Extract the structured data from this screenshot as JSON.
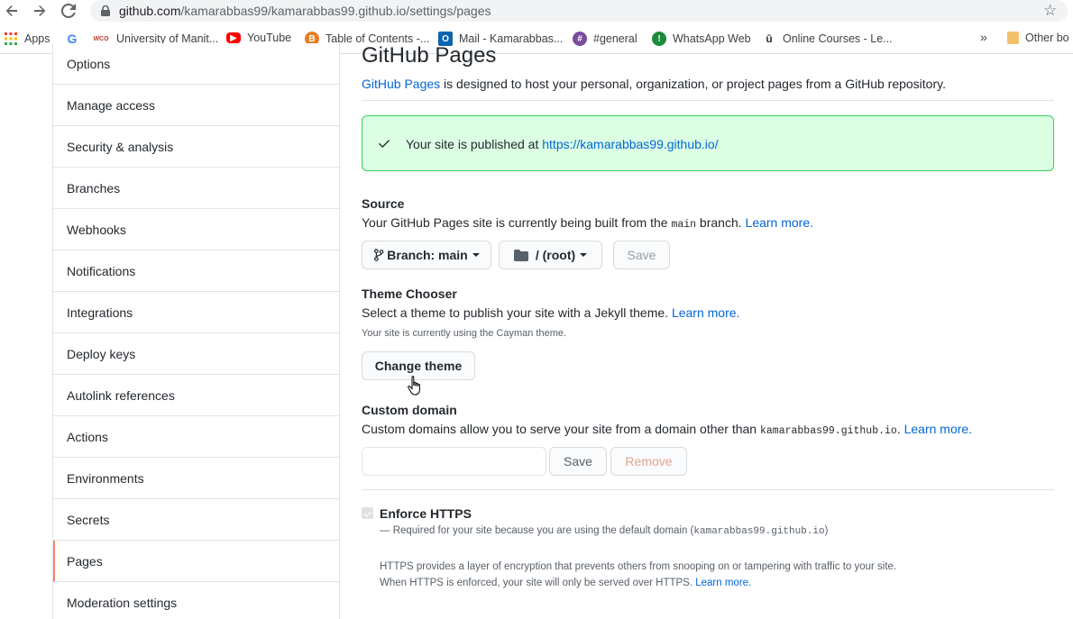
{
  "browser": {
    "url_host": "github.com",
    "url_path": "/kamarabbas99/kamarabbas99.github.io/settings/pages",
    "bookmarks": [
      {
        "label": "Apps",
        "icon": "apps-grid-icon"
      },
      {
        "label": "",
        "icon": "google-icon"
      },
      {
        "label": "University of Manit...",
        "icon": "wco-icon"
      },
      {
        "label": "YouTube",
        "icon": "youtube-icon"
      },
      {
        "label": "Table of Contents -...",
        "icon": "bookmark-b-icon"
      },
      {
        "label": "Mail - Kamarabbas...",
        "icon": "outlook-icon"
      },
      {
        "label": "#general",
        "icon": "slack-icon"
      },
      {
        "label": "WhatsApp Web",
        "icon": "whatsapp-icon"
      },
      {
        "label": "Online Courses - Le...",
        "icon": "udemy-icon"
      },
      {
        "label": "Other bo",
        "icon": "folder-icon"
      }
    ],
    "more_bookmarks": "»"
  },
  "sidebar": {
    "items": [
      {
        "label": "Options"
      },
      {
        "label": "Manage access"
      },
      {
        "label": "Security & analysis"
      },
      {
        "label": "Branches"
      },
      {
        "label": "Webhooks"
      },
      {
        "label": "Notifications"
      },
      {
        "label": "Integrations"
      },
      {
        "label": "Deploy keys"
      },
      {
        "label": "Autolink references"
      },
      {
        "label": "Actions"
      },
      {
        "label": "Environments"
      },
      {
        "label": "Secrets"
      },
      {
        "label": "Pages"
      },
      {
        "label": "Moderation settings"
      }
    ],
    "selected": "Pages"
  },
  "main": {
    "title": "GitHub Pages",
    "intro_link": "GitHub Pages",
    "intro_text": " is designed to host your personal, organization, or project pages from a GitHub repository.",
    "flash": {
      "text": "Your site is published at ",
      "link": "https://kamarabbas99.github.io/"
    },
    "source": {
      "heading": "Source",
      "desc_before": "Your GitHub Pages site is currently being built from the ",
      "desc_code": "main",
      "desc_after": " branch. ",
      "learn_more": "Learn more.",
      "branch_button": "Branch: main",
      "folder_button": "/ (root)",
      "save": "Save"
    },
    "theme": {
      "heading": "Theme Chooser",
      "desc": "Select a theme to publish your site with a Jekyll theme. ",
      "learn_more": "Learn more.",
      "note": "Your site is currently using the Cayman theme.",
      "button": "Change theme"
    },
    "custom_domain": {
      "heading": "Custom domain",
      "desc_before": "Custom domains allow you to serve your site from a domain other than ",
      "desc_code": "kamarabbas99.github.io",
      "desc_after": ". ",
      "learn_more": "Learn more.",
      "input_value": "",
      "save": "Save",
      "remove": "Remove"
    },
    "https": {
      "label": "Enforce HTTPS",
      "checked": true,
      "note_before": "— Required for your site because you are using the default domain (",
      "note_code": "kamarabbas99.github.io",
      "note_after": ")",
      "info_line1": "HTTPS provides a layer of encryption that prevents others from snooping on or tampering with traffic to your site.",
      "info_line2": "When HTTPS is enforced, your site will only be served over HTTPS. ",
      "learn_more": "Learn more."
    }
  },
  "colors": {
    "link": "#0366d6",
    "flash_bg": "#dcffe4",
    "flash_border": "#34d058",
    "selected_accent": "#f9826c"
  }
}
